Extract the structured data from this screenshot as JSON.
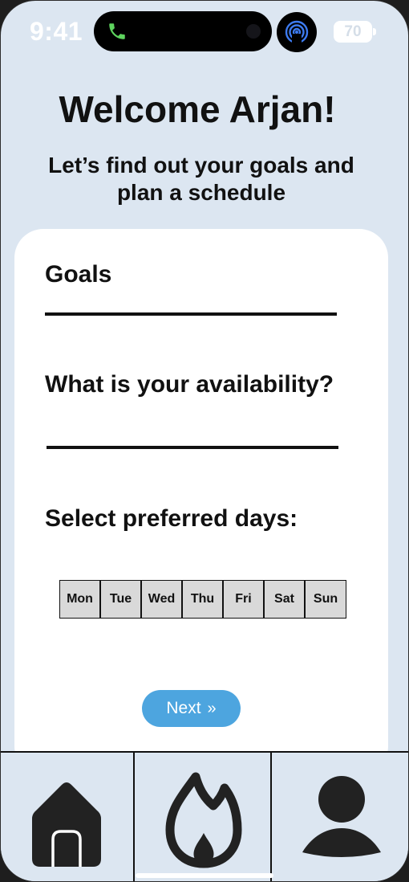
{
  "status_bar": {
    "time": "9:41",
    "battery": "70"
  },
  "header": {
    "title": "Welcome Arjan!",
    "subtitle": "Let’s find out your goals and plan a schedule"
  },
  "form": {
    "goals_label": "Goals",
    "goals_value": "",
    "availability_label": "What is your availability?",
    "availability_value": "",
    "days_label": "Select preferred days:",
    "days": [
      "Mon",
      "Tue",
      "Wed",
      "Thu",
      "Fri",
      "Sat",
      "Sun"
    ],
    "next_label": "Next",
    "next_icon": "double-chevron-right-icon"
  },
  "bottom_nav": {
    "items": [
      "home-icon",
      "flame-icon",
      "profile-icon"
    ]
  },
  "colors": {
    "background": "#dce6f1",
    "card": "#ffffff",
    "accent": "#4da5df",
    "day_chip": "#d9d9d9"
  }
}
